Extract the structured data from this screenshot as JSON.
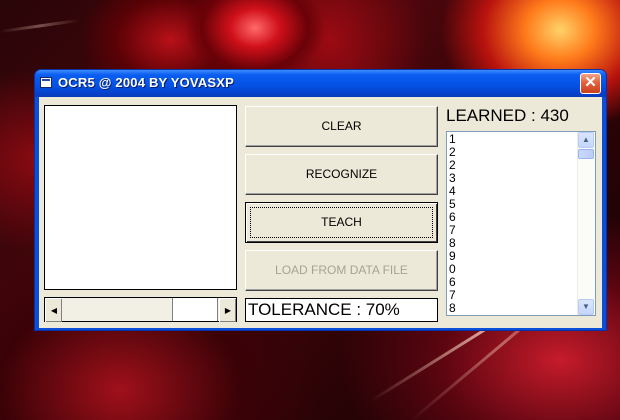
{
  "window": {
    "title": "OCR5 @ 2004 BY YOVASXP",
    "close_glyph": "✕"
  },
  "buttons": {
    "clear": "CLEAR",
    "recognize": "RECOGNIZE",
    "teach": "TEACH",
    "load": "LOAD FROM DATA FILE"
  },
  "tolerance": {
    "text": "TOLERANCE : 70%",
    "value_percent": 70
  },
  "learned": {
    "text": "LEARNED : 430",
    "count": 430
  },
  "list": {
    "items": [
      "1",
      "2",
      "2",
      "3",
      "4",
      "5",
      "6",
      "7",
      "8",
      "9",
      "0",
      "6",
      "7",
      "8"
    ]
  },
  "icons": {
    "app": "app-window-icon",
    "scroll_left": "◀",
    "scroll_right": "▶",
    "scroll_up": "▲",
    "scroll_down": "▼"
  },
  "colors": {
    "titlebar": "#0552e6",
    "close_button": "#e3613c",
    "face": "#ece9d8",
    "disabled_text": "#a6a394"
  }
}
